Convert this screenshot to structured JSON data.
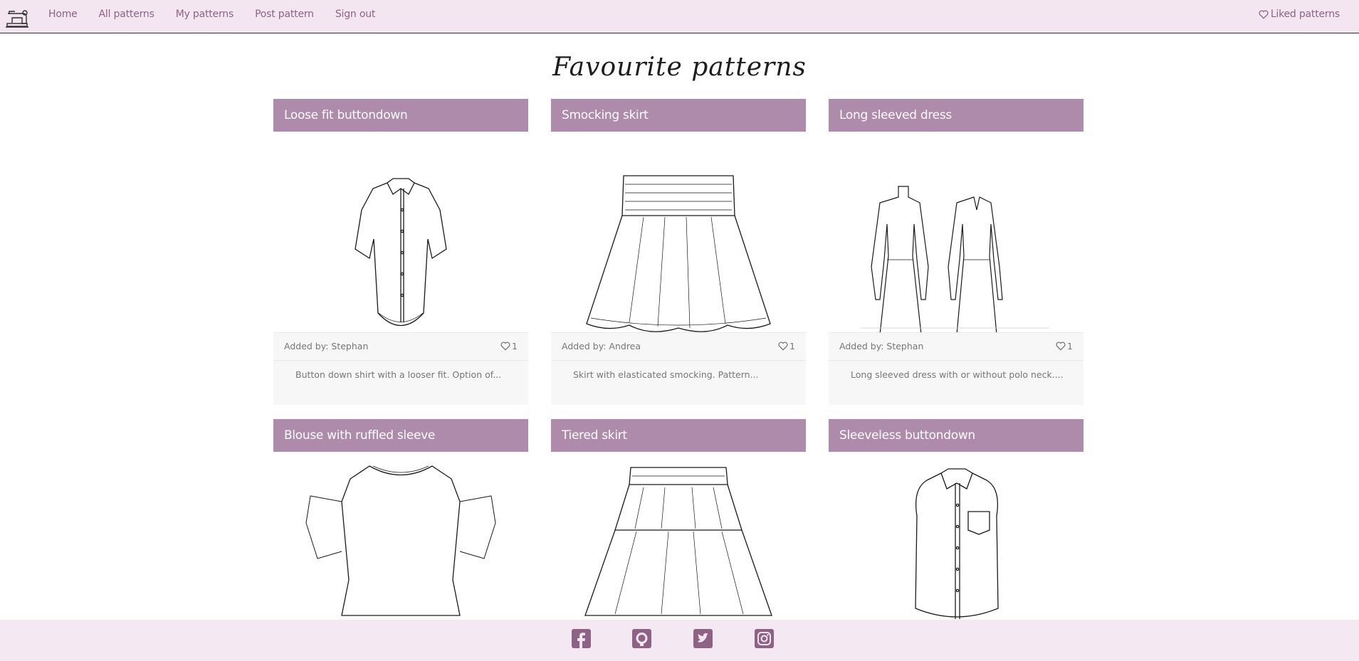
{
  "nav": {
    "logo_icon": "sewing-machine-icon",
    "links": [
      "Home",
      "All patterns",
      "My patterns",
      "Post pattern",
      "Sign out"
    ],
    "liked_label": "Liked patterns",
    "liked_icon": "heart-outline-icon"
  },
  "page": {
    "title": "Favourite patterns"
  },
  "cards": [
    {
      "title": "Loose fit buttondown",
      "author": "Added by: Stephan",
      "likes": "1",
      "description": "Button down shirt with a looser fit. Option of..."
    },
    {
      "title": "Smocking skirt",
      "author": "Added by: Andrea",
      "likes": "1",
      "description": "Skirt with elasticated smocking. Pattern..."
    },
    {
      "title": "Long sleeved dress",
      "author": "Added by: Stephan",
      "likes": "1",
      "description": "Long sleeved dress with or without polo neck...."
    },
    {
      "title": "Blouse with ruffled sleeve"
    },
    {
      "title": "Tiered skirt"
    },
    {
      "title": "Sleeveless buttondown"
    }
  ],
  "footer": {
    "icons": [
      "facebook-icon",
      "github-icon",
      "twitter-icon",
      "instagram-icon"
    ]
  },
  "colors": {
    "nav_bg": "#f3e6f1",
    "link": "#8e6285",
    "card_header": "#ae8aab",
    "meta_bg": "#f7f7f7"
  }
}
